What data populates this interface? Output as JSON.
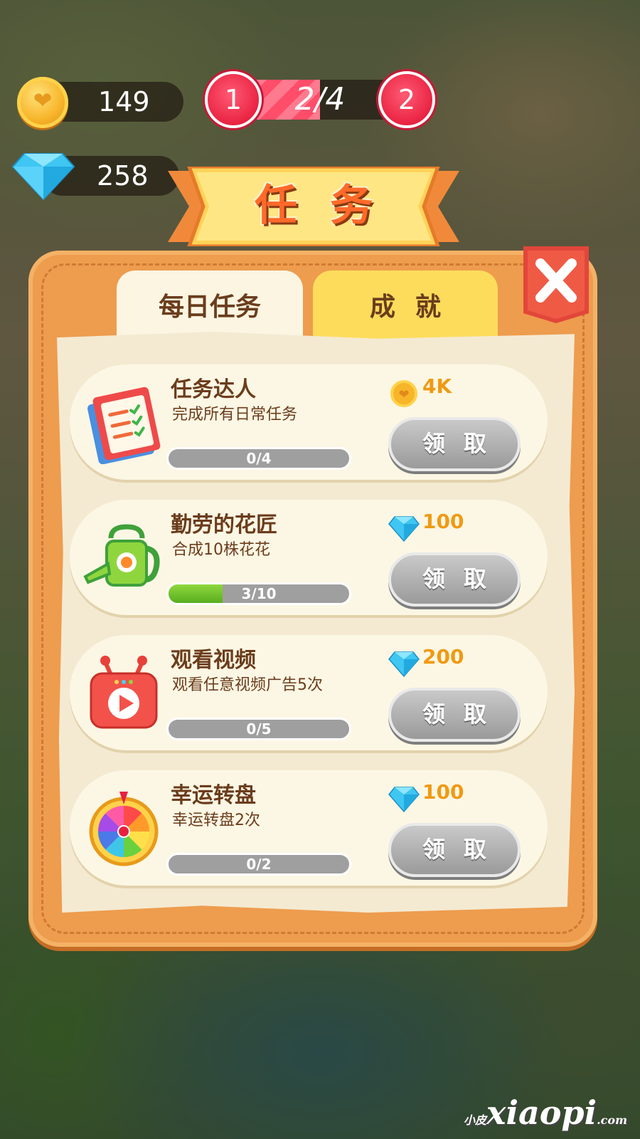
{
  "hud": {
    "coins": "149",
    "gems": "258",
    "level_progress_text": "2/4",
    "level_progress": 0.5,
    "current_level": "1",
    "next_level": "2"
  },
  "title": "任务",
  "tabs": [
    {
      "label": "每日任务",
      "active": true
    },
    {
      "label": "成就",
      "active": false
    }
  ],
  "tasks": [
    {
      "title": "任务达人",
      "desc": "完成所有日常任务",
      "progress_text": "0/4",
      "progress": 0,
      "reward_type": "coin",
      "reward": "4K",
      "claim_label": "领取",
      "icon": "clipboard-icon"
    },
    {
      "title": "勤劳的花匠",
      "desc": "合成10株花花",
      "progress_text": "3/10",
      "progress": 0.3,
      "reward_type": "gem",
      "reward": "100",
      "claim_label": "领取",
      "icon": "watering-can-icon"
    },
    {
      "title": "观看视频",
      "desc": "观看任意视频广告5次",
      "progress_text": "0/5",
      "progress": 0,
      "reward_type": "gem",
      "reward": "200",
      "claim_label": "领取",
      "icon": "video-icon"
    },
    {
      "title": "幸运转盘",
      "desc": "幸运转盘2次",
      "progress_text": "0/2",
      "progress": 0,
      "reward_type": "gem",
      "reward": "100",
      "claim_label": "领取",
      "icon": "lucky-wheel-icon"
    }
  ],
  "watermark": {
    "small": "小皮",
    "main": "xiaopi",
    "suffix": ".com"
  },
  "colors": {
    "accent": "#ee9c4e",
    "reward": "#f09a12",
    "progress": "#59ad1f",
    "level": "#e8203f"
  }
}
